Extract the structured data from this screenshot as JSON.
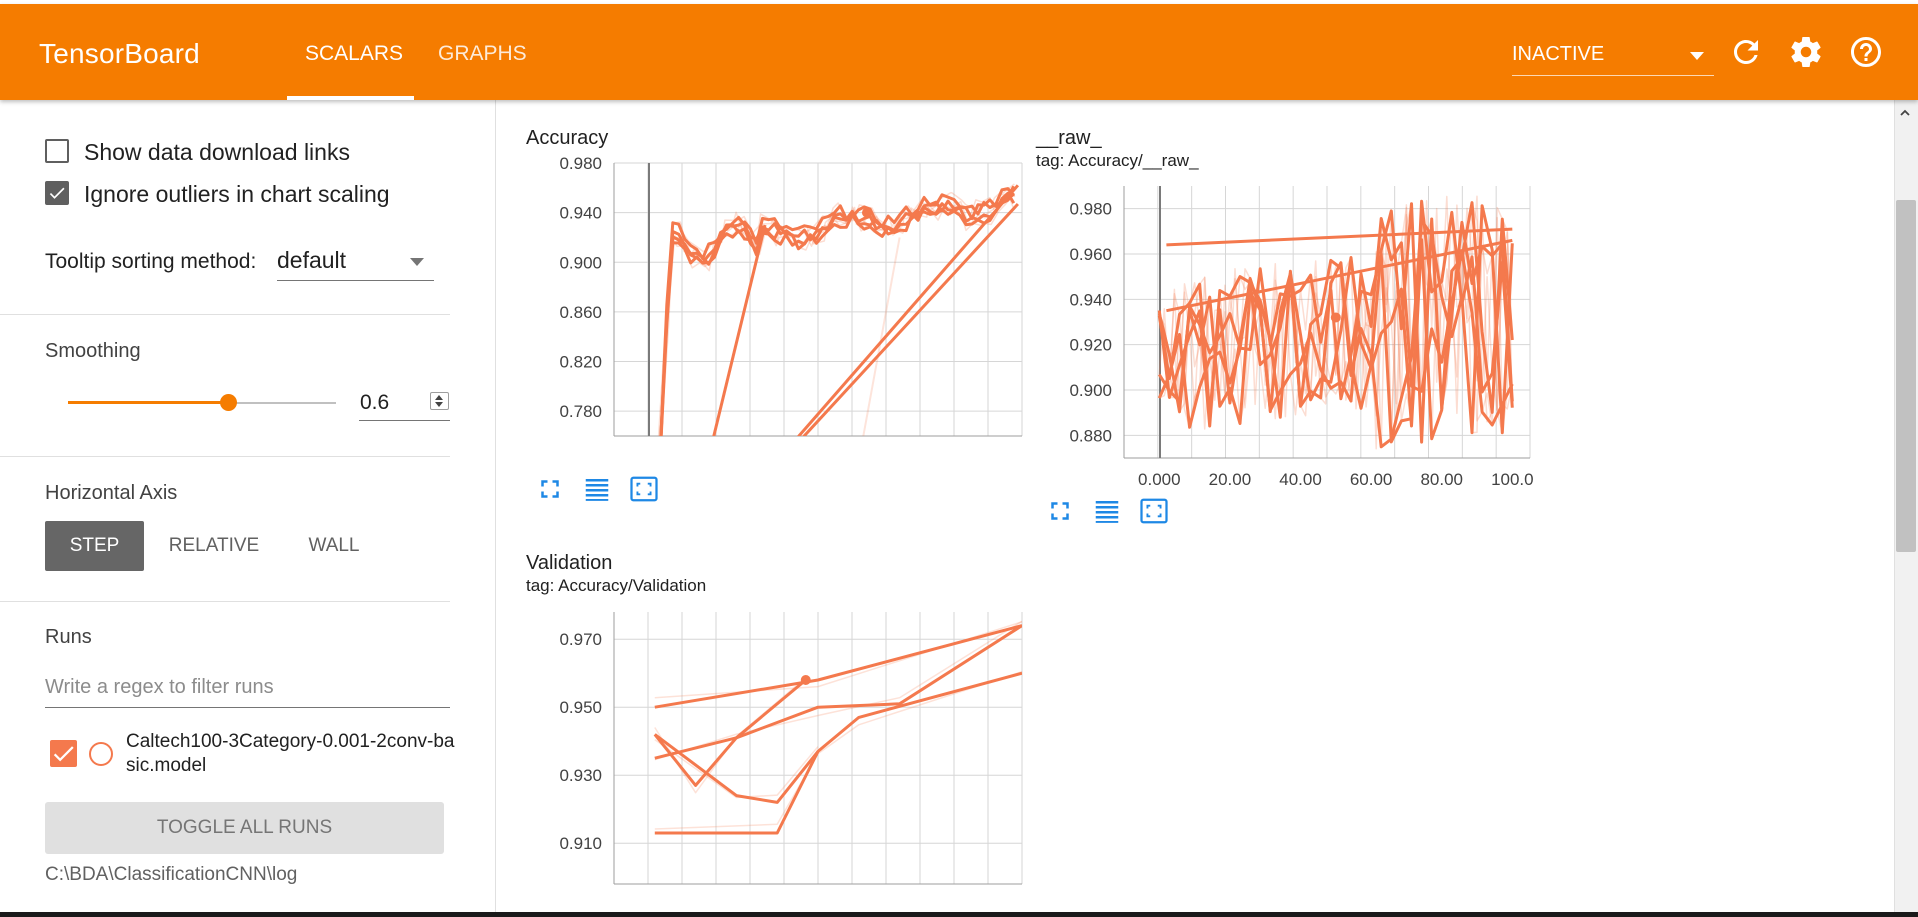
{
  "app": {
    "title": "TensorBoard",
    "tabs": [
      "SCALARS",
      "GRAPHS"
    ],
    "active_tab": "SCALARS",
    "status": "INACTIVE",
    "accent_color": "#f57c00",
    "icons": [
      "reload-icon",
      "gear-icon",
      "help-icon"
    ]
  },
  "sidebar": {
    "show_download_links": {
      "label": "Show data download links",
      "checked": false
    },
    "ignore_outliers": {
      "label": "Ignore outliers in chart scaling",
      "checked": true
    },
    "tooltip_sorting": {
      "label": "Tooltip sorting method:",
      "value": "default"
    },
    "smoothing": {
      "title": "Smoothing",
      "value": "0.6",
      "slider_fraction": 0.6
    },
    "horizontal_axis": {
      "title": "Horizontal Axis",
      "options": [
        "STEP",
        "RELATIVE",
        "WALL"
      ],
      "selected": "STEP"
    },
    "runs": {
      "title": "Runs",
      "filter_placeholder": "Write a regex to filter runs",
      "run_name": "Caltech100-3Category-0.001-2conv-basic.model",
      "run_color": "#f4794d",
      "toggle_label": "TOGGLE ALL RUNS",
      "logdir": "C:\\BDA\\ClassificationCNN\\log"
    }
  },
  "chart_data": [
    {
      "type": "line",
      "title": "Accuracy",
      "tag": "",
      "ylim": [
        0.76,
        0.98
      ],
      "yticks": [
        "0.980",
        "0.940",
        "0.900",
        "0.860",
        "0.820",
        "0.780"
      ],
      "ytick_values": [
        0.98,
        0.94,
        0.9,
        0.86,
        0.82,
        0.78
      ],
      "xticks": [],
      "series_color": "#f4794d",
      "marker": [
        0.62,
        0.94
      ]
    },
    {
      "type": "line",
      "title": "__raw_",
      "tag": "tag: Accuracy/__raw_",
      "xlim": [
        -10,
        105
      ],
      "ylim": [
        0.87,
        0.99
      ],
      "yticks": [
        "0.980",
        "0.960",
        "0.940",
        "0.920",
        "0.900",
        "0.880"
      ],
      "ytick_values": [
        0.98,
        0.96,
        0.94,
        0.92,
        0.9,
        0.88
      ],
      "xticks": [
        "0.000",
        "20.00",
        "40.00",
        "60.00",
        "80.00",
        "100.0"
      ],
      "xtick_values": [
        0,
        20,
        40,
        60,
        80,
        100
      ],
      "series_color": "#f4794d",
      "marker": [
        50,
        0.932
      ]
    },
    {
      "type": "line",
      "title": "Validation",
      "tag": "tag: Accuracy/Validation",
      "ylim": [
        0.898,
        0.978
      ],
      "yticks": [
        "0.970",
        "0.950",
        "0.930",
        "0.910"
      ],
      "ytick_values": [
        0.97,
        0.95,
        0.93,
        0.91
      ],
      "xticks": [],
      "series_color": "#f4794d",
      "marker": [
        0.47,
        0.958
      ]
    }
  ]
}
